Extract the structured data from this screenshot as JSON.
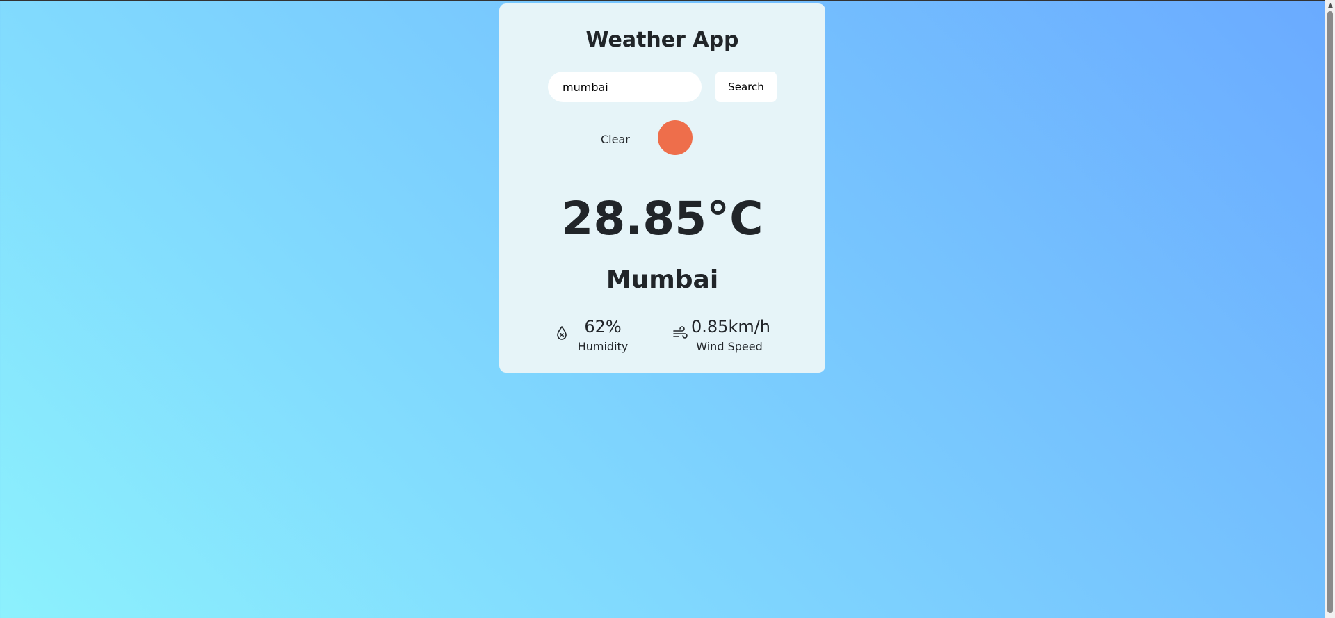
{
  "app": {
    "title": "Weather App"
  },
  "search": {
    "value": "mumbai",
    "button_label": "Search"
  },
  "weather": {
    "condition": "Clear",
    "condition_icon": "sun-circle-icon",
    "temperature": "28.85°C",
    "city": "Mumbai",
    "humidity": {
      "value": "62%",
      "label": "Humidity",
      "icon": "humidity-drop-icon"
    },
    "wind": {
      "value": "0.85km/h",
      "label": "Wind Speed",
      "icon": "wind-icon"
    }
  },
  "colors": {
    "background_start": "#8cf1fd",
    "background_end": "#6aaaff",
    "card": "#e6f4f8",
    "sun": "#ee6e4b",
    "text": "#212529"
  }
}
